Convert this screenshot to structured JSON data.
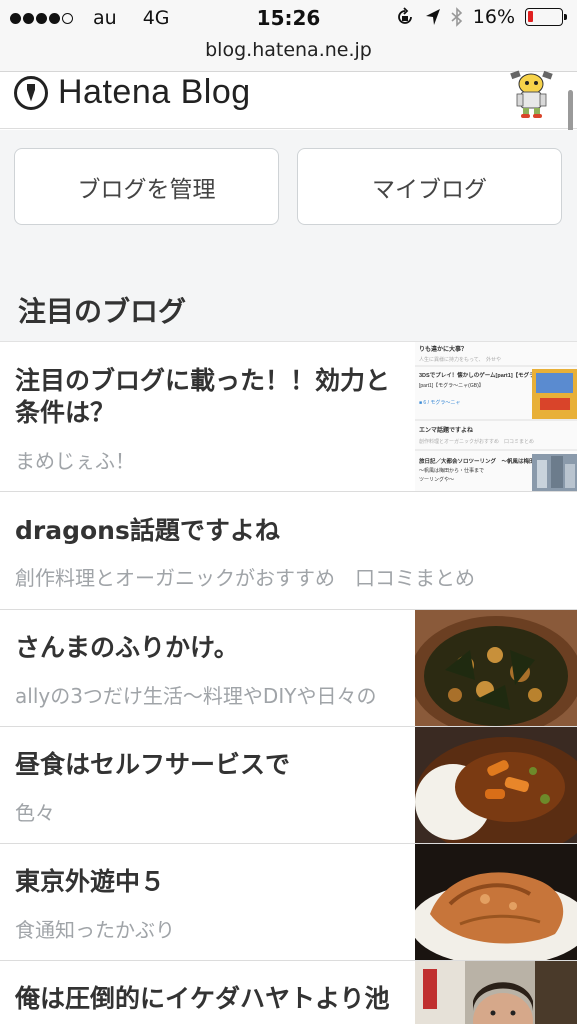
{
  "status_bar": {
    "carrier": "au",
    "network": "4G",
    "time": "15:26",
    "battery_percent": "16%",
    "battery_level": 0.16,
    "icons": [
      "signal-dots-icon",
      "rotation-lock-icon",
      "location-arrow-icon",
      "bluetooth-icon",
      "battery-icon"
    ]
  },
  "url_bar": {
    "url": "blog.hatena.ne.jp"
  },
  "header": {
    "logo_text": "Hatena Blog",
    "mascot": "mascot-character"
  },
  "actions": {
    "manage_label": "ブログを管理",
    "myblog_label": "マイブログ"
  },
  "section": {
    "title": "注目のブログ"
  },
  "entries": [
    {
      "title": "注目のブログに載った！！効力と条件は？",
      "subtitle": "まめじぇふ！",
      "thumb": "screenshot"
    },
    {
      "title": "dragons話題ですよね",
      "subtitle": "創作料理とオーガニックがおすすめ　口コミまとめ",
      "thumb": "none"
    },
    {
      "title": "さんまのふりかけ。",
      "subtitle": "allyの3つだけ生活〜料理やDIYや日々の",
      "thumb": "furikake"
    },
    {
      "title": "昼食はセルフサービスで",
      "subtitle": "色々",
      "thumb": "curry"
    },
    {
      "title": "東京外遊中５",
      "subtitle": "食通知ったかぶり",
      "thumb": "chicken"
    },
    {
      "title": "俺は圧倒的にイケダハヤトより池",
      "subtitle": "",
      "thumb": "street"
    }
  ],
  "thumb_screenshot": {
    "line1": "りも違かに大事？",
    "line2": "3DSでプレイ！懐かしのゲーム[part1]【モグラ〜ニャ(GB)】を遊ぶ",
    "line3": "エンマ話題ですよね",
    "line4": "旅日記／大都会ソロツーリング　〜帆風は梅田から・仕事までツーリングや〜"
  },
  "colors": {
    "battery_low": "#e02020",
    "gray_bg": "#f4f5f6",
    "subtitle": "#a0a4a8"
  }
}
